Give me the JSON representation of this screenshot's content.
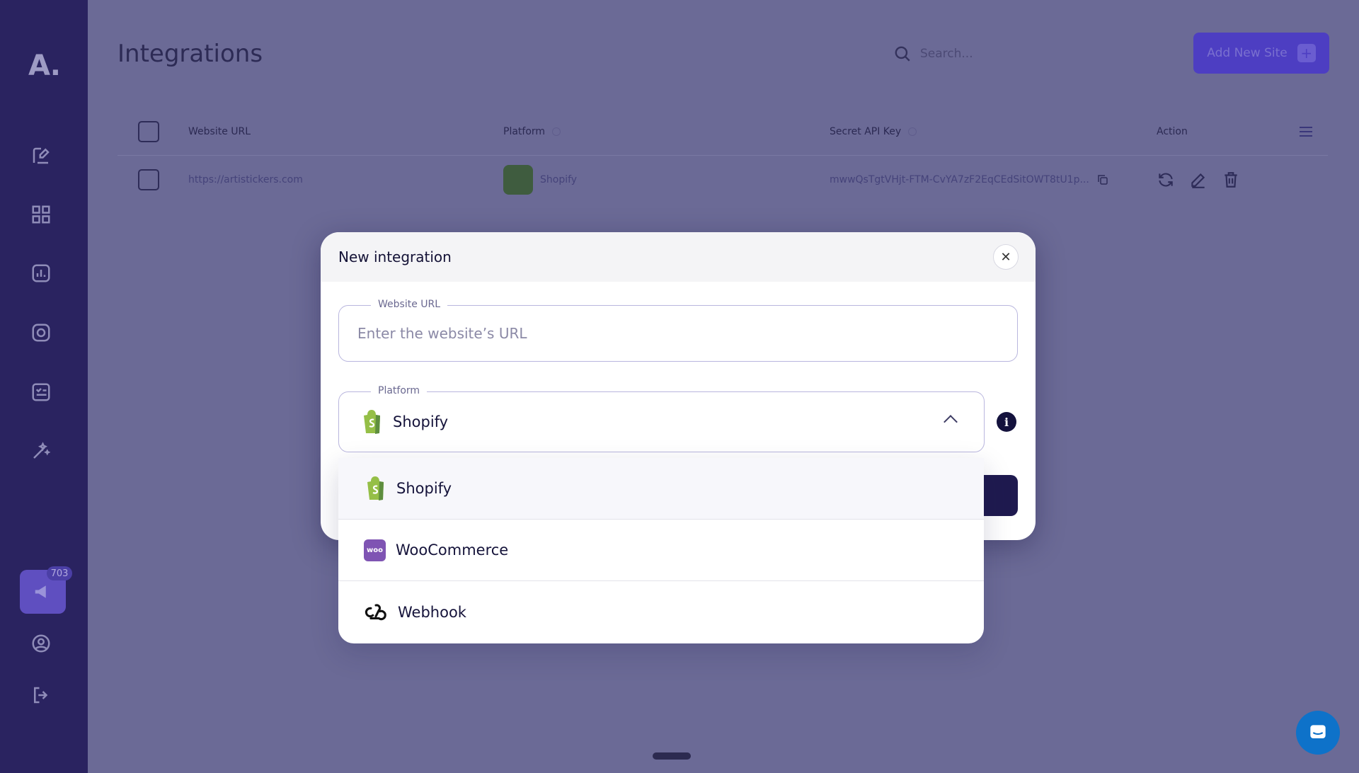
{
  "app": {
    "logo": "A."
  },
  "sidebar": {
    "promo_count": "703"
  },
  "page": {
    "title": "Integrations"
  },
  "search": {
    "placeholder": "Search..."
  },
  "add_site": {
    "label": "Add New Site"
  },
  "table": {
    "headers": {
      "url": "Website URL",
      "platform": "Platform",
      "key": "Secret API Key",
      "action": "Action"
    },
    "rows": [
      {
        "url": "https://artistickers.com",
        "platform": "Shopify",
        "key": "mwwQsTgtVHjt-FTM-CvYA7zF2EqCEdSitOWT8tU1p..."
      }
    ]
  },
  "modal": {
    "title": "New integration",
    "url_legend": "Website URL",
    "url_placeholder": "Enter the website’s URL",
    "platform_legend": "Platform",
    "platform_selected": "Shopify",
    "options": [
      {
        "label": "Shopify",
        "icon": "shopify-icon"
      },
      {
        "label": "WooCommerce",
        "icon": "woocommerce-icon"
      },
      {
        "label": "Webhook",
        "icon": "webhook-icon"
      }
    ]
  },
  "colors": {
    "sidebar": "#2a2360",
    "accent": "#4d3ec2",
    "modal_dark": "#1f1a4f",
    "chat": "#0e72c9"
  }
}
